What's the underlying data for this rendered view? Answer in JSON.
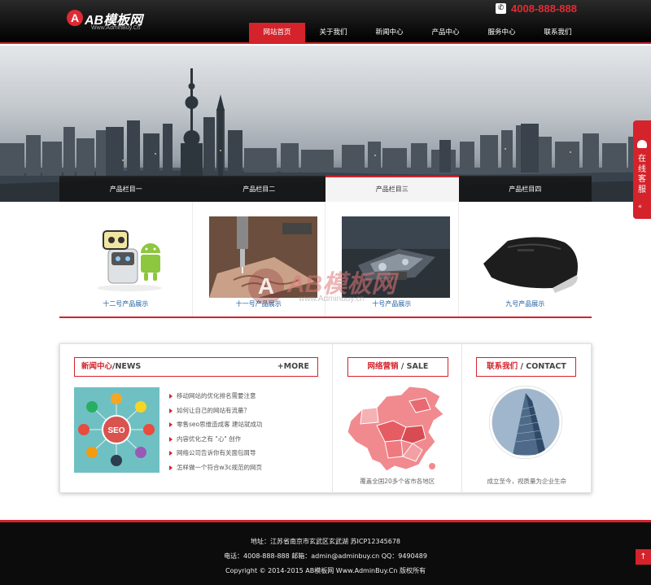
{
  "header": {
    "logo_mark": "A",
    "logo_text": "AB模板网",
    "logo_sub": "Www.AdminBuy.Cn",
    "phone": "4008-888-888",
    "nav": [
      "网站首页",
      "关于我们",
      "新闻中心",
      "产品中心",
      "服务中心",
      "联系我们"
    ],
    "active_nav": 0
  },
  "products": {
    "tabs": [
      "产品栏目一",
      "产品栏目二",
      "产品栏目三",
      "产品栏目四"
    ],
    "active_tab": 2,
    "items": [
      {
        "caption": "十二号产品展示",
        "icon": "robot-android-image"
      },
      {
        "caption": "十一号产品展示",
        "icon": "engraving-machine-image"
      },
      {
        "caption": "十号产品展示",
        "icon": "machine-part-image"
      },
      {
        "caption": "九号产品展示",
        "icon": "mouse-image"
      }
    ]
  },
  "watermark": {
    "mark": "A",
    "text": "AB模板网",
    "sub": "www.Adminbuy.cn"
  },
  "news": {
    "title_cn": "新闻中心",
    "title_en": "/NEWS",
    "more": "+MORE",
    "items": [
      "移动网站的优化排名需要注意",
      "如何让自己的网站有流量？",
      "零售seo思维造成客 建站就成功",
      "内容优化之有 \"心\" 创作",
      "网络公司告诉你有关面包屑导",
      "怎样做一个符合w3c规范的网页"
    ],
    "seo_label": "SEO"
  },
  "sale": {
    "title_cn": "网络营销",
    "title_en": " / SALE",
    "caption": "覆盖全国20多个省市各地区"
  },
  "contact": {
    "title_cn": "联系我们",
    "title_en": " / CONTACT",
    "caption": "成立至今，视质量为企业生命"
  },
  "service": {
    "label": "在线客服",
    "arrow": "«"
  },
  "to_top": "↑",
  "footer": {
    "line1": "地址：江苏省南京市玄武区玄武湖    苏ICP12345678",
    "line2": "电话：4008-888-888    邮箱：admin@adminbuy.cn    QQ：9490489",
    "line3": "Copyright © 2014-2015 AB模板网 Www.AdminBuy.Cn 版权所有"
  },
  "colors": {
    "accent": "#d4232b",
    "header_bg": "#000000",
    "footer_bg": "#0c0c0c",
    "caption_blue": "#1a5b9c"
  }
}
